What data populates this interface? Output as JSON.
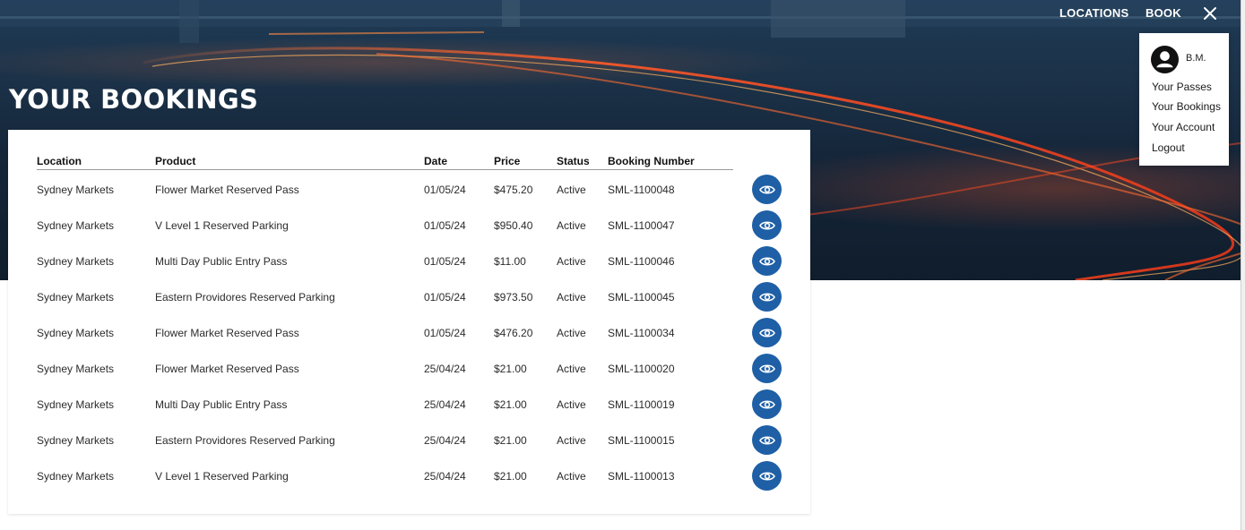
{
  "header": {
    "nav": {
      "locations": "LOCATIONS",
      "book": "BOOK"
    },
    "close_icon": "close-icon"
  },
  "page": {
    "title": "YOUR BOOKINGS"
  },
  "table": {
    "columns": [
      "Location",
      "Product",
      "Date",
      "Price",
      "Status",
      "Booking Number"
    ],
    "rows": [
      {
        "location": "Sydney Markets",
        "product": "Flower Market Reserved Pass",
        "date": "01/05/24",
        "price": "$475.20",
        "status": "Active",
        "booking_number": "SML-1100048"
      },
      {
        "location": "Sydney Markets",
        "product": "V Level 1 Reserved Parking",
        "date": "01/05/24",
        "price": "$950.40",
        "status": "Active",
        "booking_number": "SML-1100047"
      },
      {
        "location": "Sydney Markets",
        "product": "Multi Day Public Entry Pass",
        "date": "01/05/24",
        "price": "$11.00",
        "status": "Active",
        "booking_number": "SML-1100046"
      },
      {
        "location": "Sydney Markets",
        "product": "Eastern Providores Reserved Parking",
        "date": "01/05/24",
        "price": "$973.50",
        "status": "Active",
        "booking_number": "SML-1100045"
      },
      {
        "location": "Sydney Markets",
        "product": "Flower Market Reserved Pass",
        "date": "01/05/24",
        "price": "$476.20",
        "status": "Active",
        "booking_number": "SML-1100034"
      },
      {
        "location": "Sydney Markets",
        "product": "Flower Market Reserved Pass",
        "date": "25/04/24",
        "price": "$21.00",
        "status": "Active",
        "booking_number": "SML-1100020"
      },
      {
        "location": "Sydney Markets",
        "product": "Multi Day Public Entry Pass",
        "date": "25/04/24",
        "price": "$21.00",
        "status": "Active",
        "booking_number": "SML-1100019"
      },
      {
        "location": "Sydney Markets",
        "product": "Eastern Providores Reserved Parking",
        "date": "25/04/24",
        "price": "$21.00",
        "status": "Active",
        "booking_number": "SML-1100015"
      },
      {
        "location": "Sydney Markets",
        "product": "V Level 1 Reserved Parking",
        "date": "25/04/24",
        "price": "$21.00",
        "status": "Active",
        "booking_number": "SML-1100013"
      }
    ],
    "row_action_icon": "eye-icon"
  },
  "user_menu": {
    "initials": "B.M.",
    "avatar_icon": "user-avatar-icon",
    "items": [
      "Your Passes",
      "Your Bookings",
      "Your Account",
      "Logout"
    ]
  },
  "colors": {
    "accent": "#1e5fa6",
    "hero_dark": "#15263a",
    "light_trail": "#ff5a28"
  }
}
